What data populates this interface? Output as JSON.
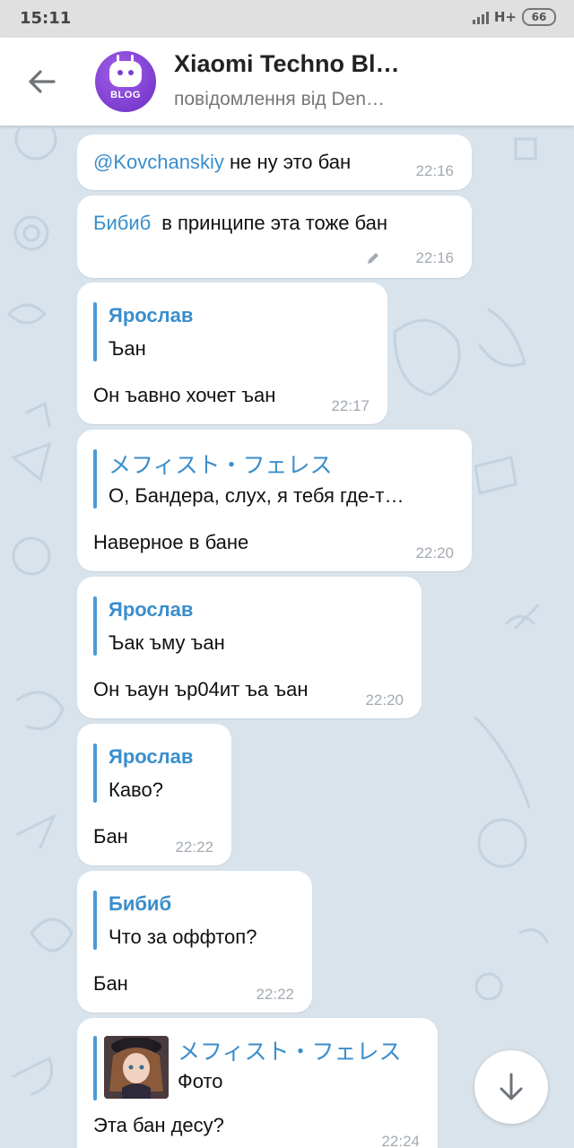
{
  "status_bar": {
    "time": "15:11",
    "network": "H+",
    "battery": "66"
  },
  "header": {
    "title": "Xiaomi Techno Bl…",
    "subtitle": "повідомлення від Den…",
    "avatar_text": "BLOG"
  },
  "messages": [
    {
      "mention": "@Kovchanskiy",
      "text": "не ну это бан",
      "time": "22:16"
    },
    {
      "sender_inline": "Бибиб",
      "text": "в принципе эта тоже бан",
      "time": "22:16",
      "edited": true
    },
    {
      "reply_name": "Ярослав",
      "reply_text": "Ъан",
      "text": "Он ъавно хочет ъан",
      "time": "22:17"
    },
    {
      "reply_name": "メフィスト・フェレス",
      "reply_text": "О, Бандера, слух, я тебя где-т…",
      "text": "Наверное в бане",
      "time": "22:20"
    },
    {
      "reply_name": "Ярослав",
      "reply_text": "Ъак ъму ъан",
      "text": "Он ъаун ър04ит ъа ъан",
      "time": "22:20"
    },
    {
      "reply_name": "Ярослав",
      "reply_text": "Каво?",
      "text": "Бан",
      "time": "22:22"
    },
    {
      "reply_name": "Бибиб",
      "reply_text": "Что за оффтоп?",
      "text": "Бан",
      "time": "22:22"
    },
    {
      "reply_name": "メフィスト・フェレス",
      "reply_text": "Фото",
      "text": "Эта бан десу?",
      "time": "22:24"
    }
  ],
  "colors": {
    "accent": "#3a8ecb",
    "chat_bg": "#d8e3ec",
    "bubble": "#ffffff",
    "time": "#a3aab2"
  }
}
